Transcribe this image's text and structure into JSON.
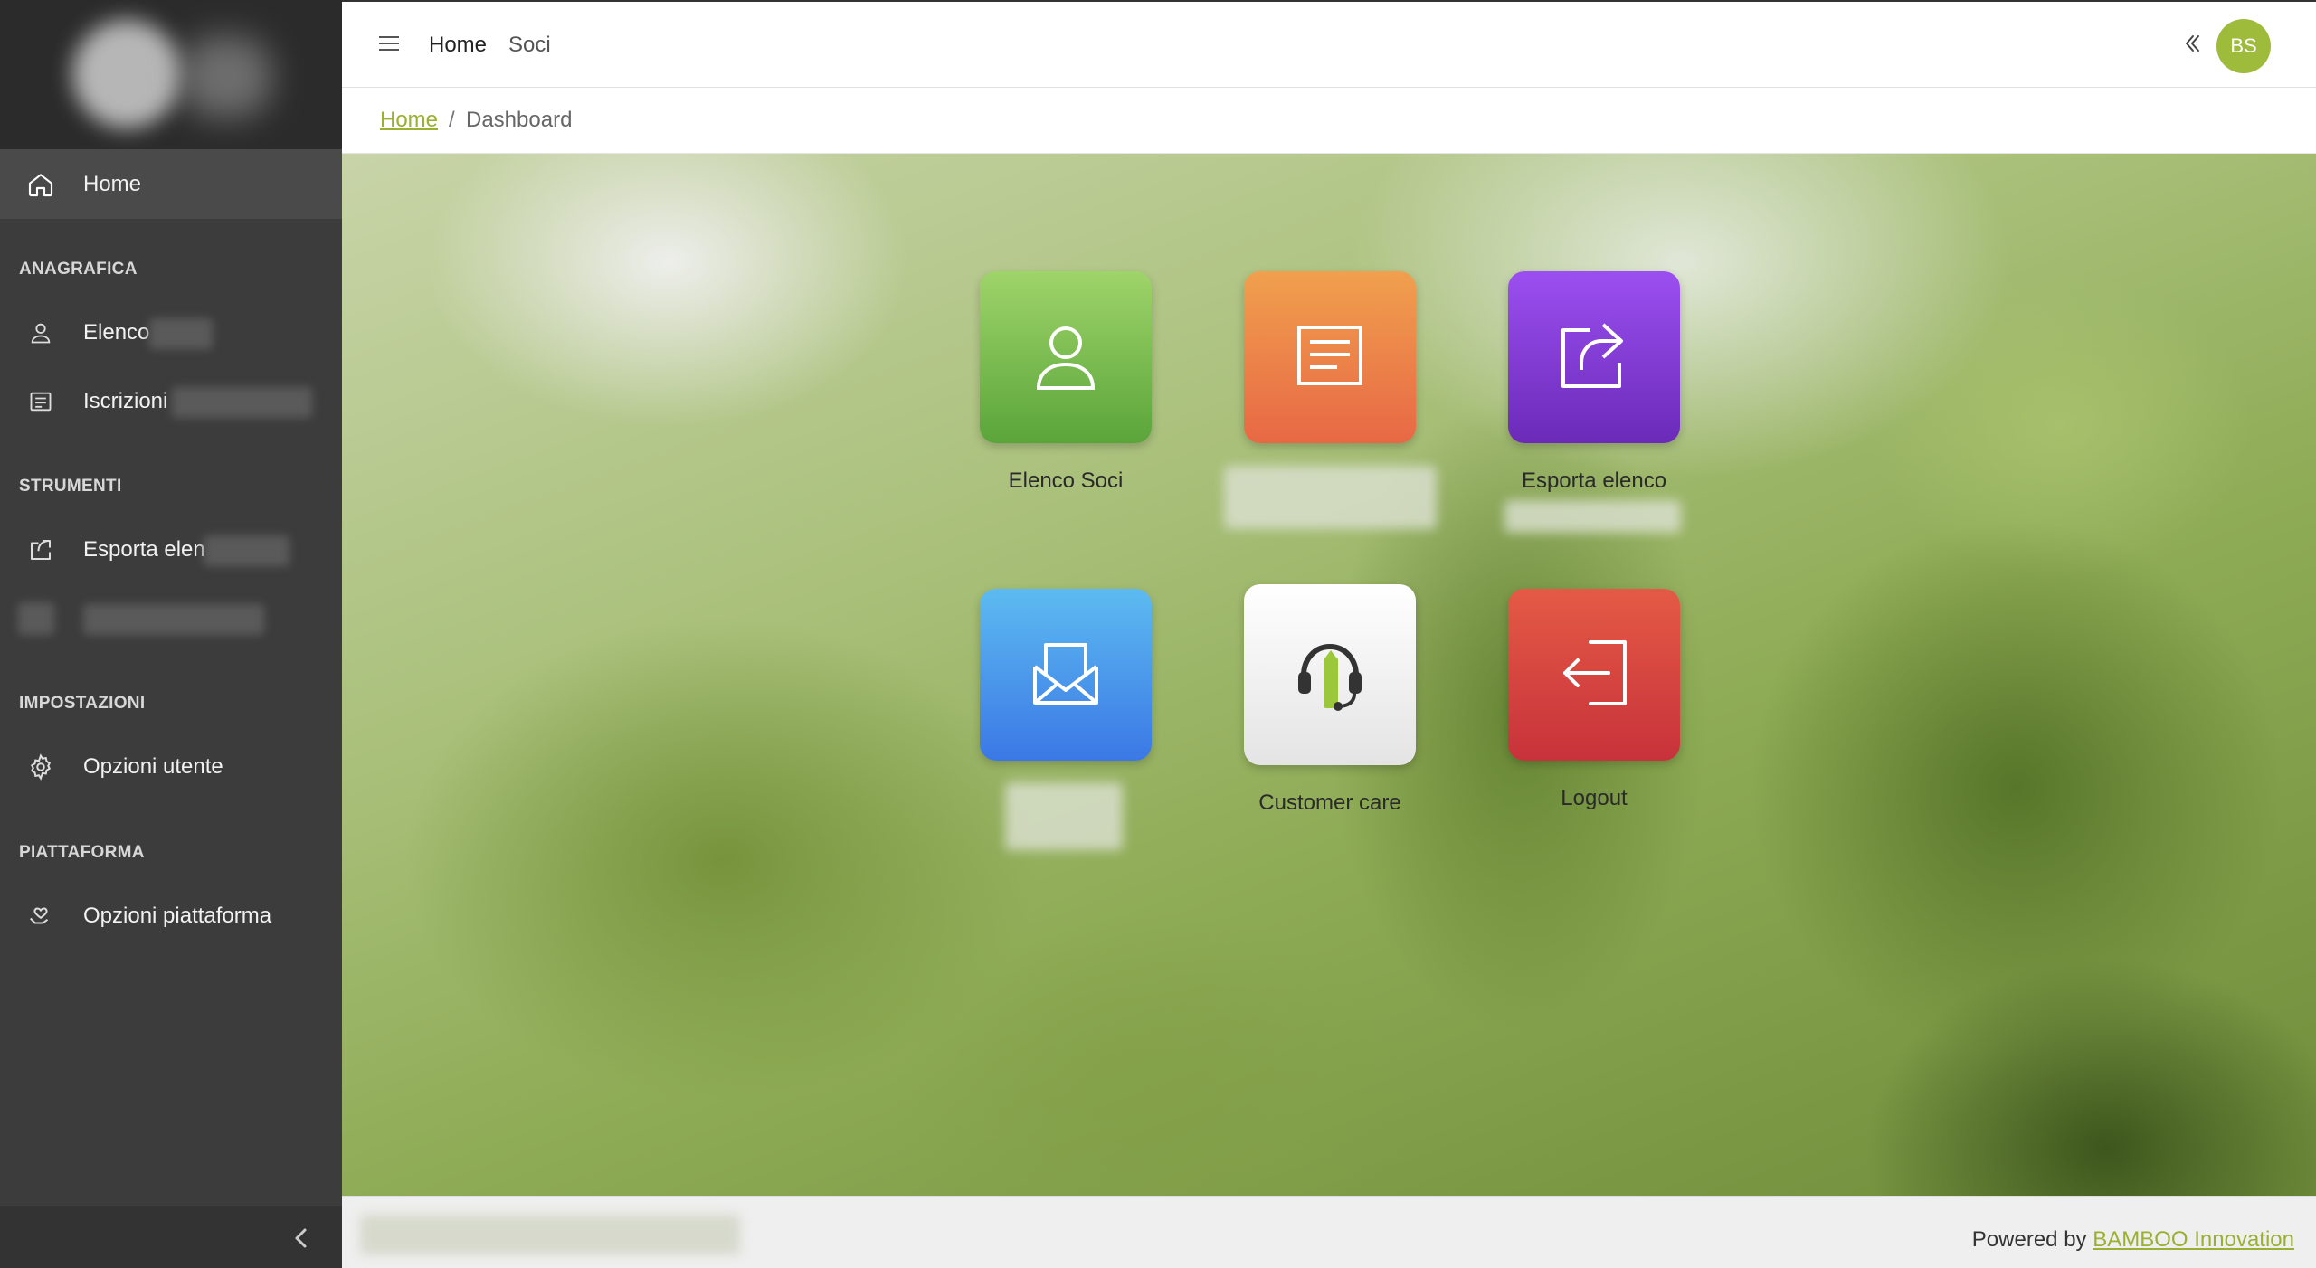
{
  "sidebar": {
    "home_label": "Home",
    "sections": {
      "anagrafica": "ANAGRAFICA",
      "strumenti": "STRUMENTI",
      "impostazioni": "IMPOSTAZIONI",
      "piattaforma": "PIATTAFORMA"
    },
    "items": {
      "elenco": "Elenco",
      "iscrizioni": "Iscrizioni",
      "esporta": "Esporta elen",
      "opzioni_utente": "Opzioni utente",
      "opzioni_piattaforma": "Opzioni piattaforma"
    }
  },
  "topbar": {
    "home": "Home",
    "soci": "Soci",
    "avatar_initials": "BS"
  },
  "breadcrumb": {
    "home": "Home",
    "separator": "/",
    "current": "Dashboard"
  },
  "tiles": {
    "elenco_soci": "Elenco Soci",
    "esporta_elenco": "Esporta elenco",
    "customer_care": "Customer care",
    "logout": "Logout"
  },
  "footer": {
    "powered_by": "Powered by",
    "brand": "BAMBOO Innovation"
  },
  "colors": {
    "accent": "#9ab032",
    "sidebar_bg": "#3c3c3c",
    "tile_green": "#6db33f",
    "tile_orange": "#ee7b3e",
    "tile_purple": "#7b38c9",
    "tile_blue": "#4a8ee8",
    "tile_red": "#d8393c"
  }
}
